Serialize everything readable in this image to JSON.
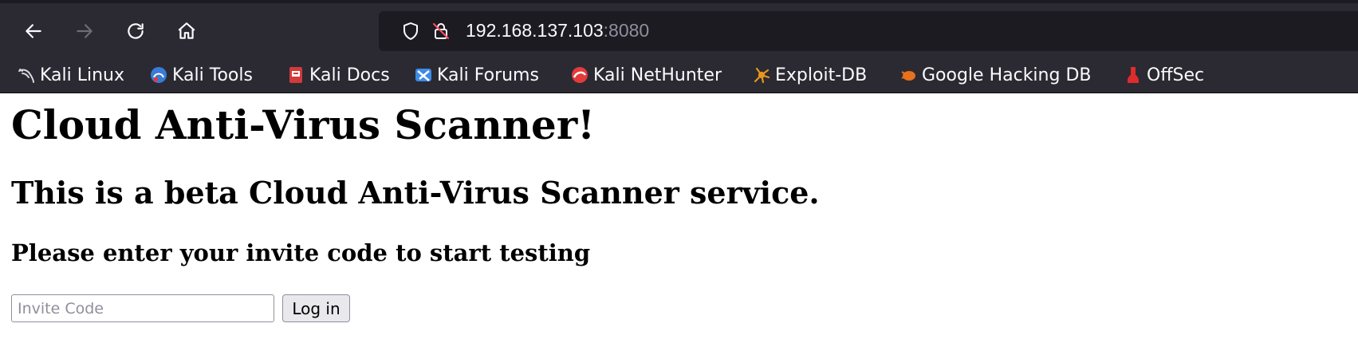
{
  "browser": {
    "nav": {
      "back_icon": "arrow-left-icon",
      "forward_icon": "arrow-right-icon",
      "reload_icon": "reload-icon",
      "home_icon": "home-icon"
    },
    "url": {
      "host": "192.168.137.103",
      "port": ":8080",
      "shield_icon": "shield-icon",
      "insecure_icon": "insecure-lock-icon"
    },
    "bookmarks": [
      {
        "label": "Kali Linux",
        "icon": "kali-dragon-icon"
      },
      {
        "label": "Kali Tools",
        "icon": "kali-tools-icon"
      },
      {
        "label": "Kali Docs",
        "icon": "kali-docs-icon"
      },
      {
        "label": "Kali Forums",
        "icon": "kali-forums-icon"
      },
      {
        "label": "Kali NetHunter",
        "icon": "nethunter-icon"
      },
      {
        "label": "Exploit-DB",
        "icon": "exploit-db-icon"
      },
      {
        "label": "Google Hacking DB",
        "icon": "ghdb-icon"
      },
      {
        "label": "OffSec",
        "icon": "offsec-icon"
      }
    ]
  },
  "page": {
    "title": "Cloud Anti-Virus Scanner!",
    "subtitle": "This is a beta Cloud Anti-Virus Scanner service.",
    "prompt": "Please enter your invite code to start testing",
    "form": {
      "invite_placeholder": "Invite Code",
      "invite_value": "",
      "login_label": "Log in"
    }
  },
  "colors": {
    "toolbar_bg": "#2b2a33",
    "urlbar_bg": "#1c1b22",
    "toolbar_text": "#fbfbfe",
    "port_text": "#8f8f9d"
  }
}
